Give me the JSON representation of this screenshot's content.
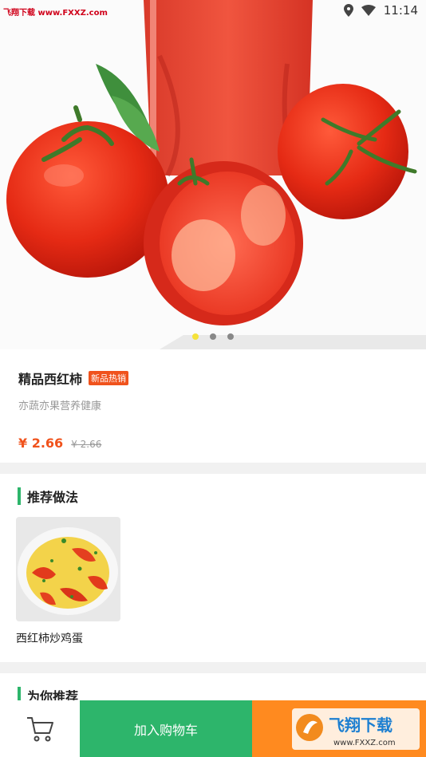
{
  "status_bar": {
    "time": "11:14",
    "watermark": "飞翔下载 www.FXXZ.com"
  },
  "carousel": {
    "image_icon": "tomato-juice-photo",
    "pages": 3,
    "active_page": 1
  },
  "product": {
    "name": "精品西红柿",
    "badge": "新品热销",
    "subtitle": "亦蔬亦果营养健康",
    "price": "¥ 2.66",
    "original_price": "¥ 2.66"
  },
  "recommend_recipes": {
    "title": "推荐做法",
    "items": [
      {
        "name": "西红柿炒鸡蛋",
        "image_icon": "tomato-egg-dish-photo"
      }
    ]
  },
  "for_you": {
    "title": "为你推荐"
  },
  "bottom_bar": {
    "cart_icon": "cart-icon",
    "add_to_cart": "加入购物车",
    "watermark_logo": "飞翔下载",
    "watermark_url": "www.FXXZ.com"
  },
  "colors": {
    "accent_green": "#2db56b",
    "accent_orange": "#ff8a1f",
    "price_red": "#f0521c"
  }
}
